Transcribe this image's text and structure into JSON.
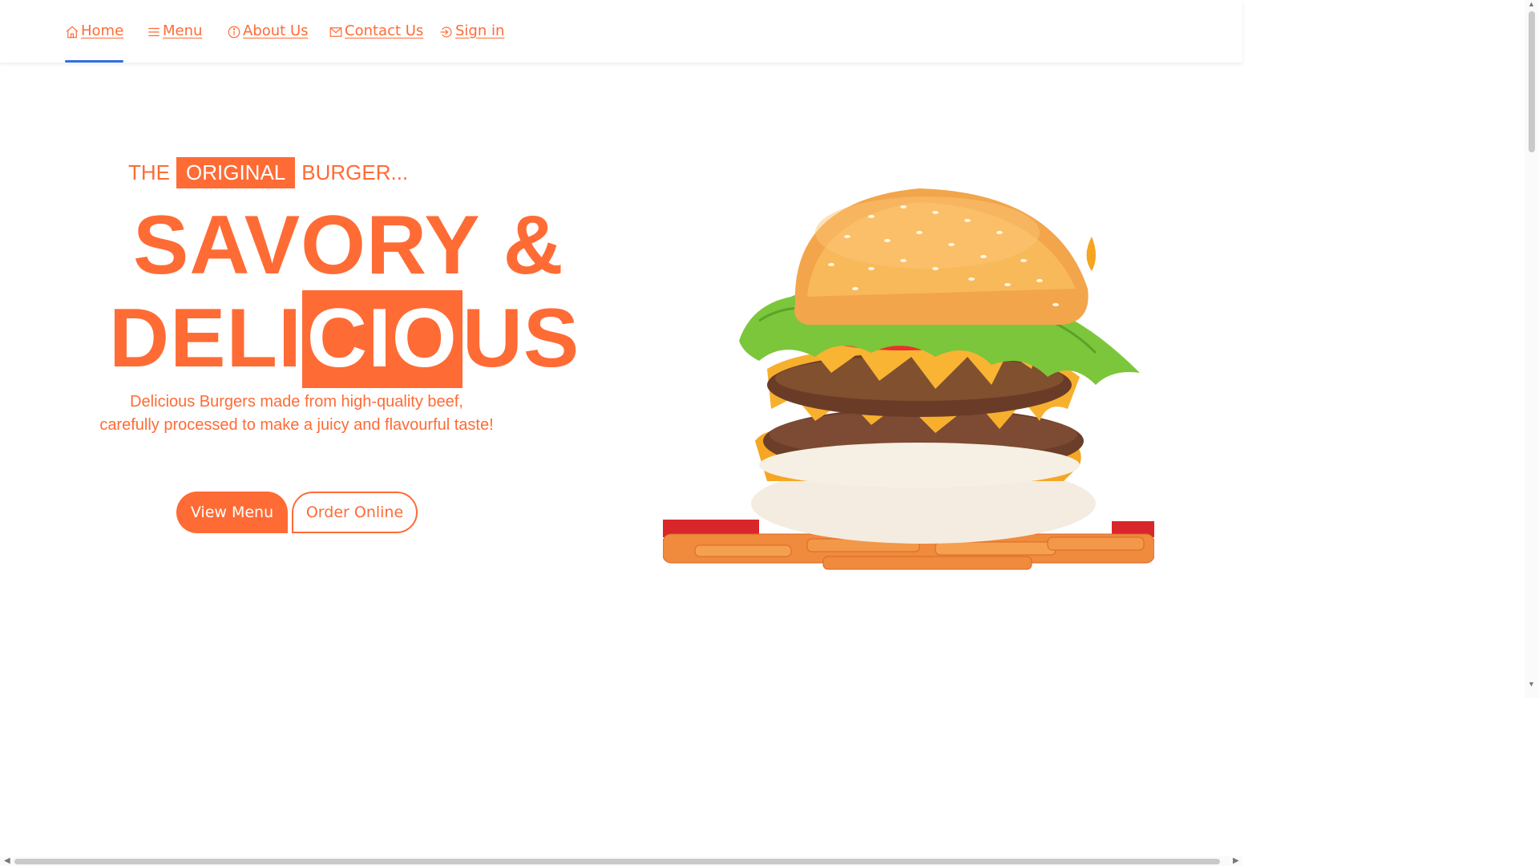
{
  "colors": {
    "accent": "#ff6b35",
    "active_underline": "#2f6fe0"
  },
  "nav": {
    "items": [
      {
        "label": "Home",
        "icon": "home-icon",
        "active": true
      },
      {
        "label": "Menu",
        "icon": "menu-icon"
      },
      {
        "label": "About Us",
        "icon": "info-icon"
      },
      {
        "label": "Contact Us",
        "icon": "mail-icon"
      },
      {
        "label": "Sign in",
        "icon": "sign-in-icon"
      }
    ]
  },
  "hero": {
    "tagline": {
      "before": "THE",
      "highlight": "ORIGINAL",
      "after": "BURGER..."
    },
    "headline_line1": "SAVORY &",
    "headline_line2": {
      "before": "DELI",
      "highlight": "CIO",
      "after": "US"
    },
    "description_line1": "Delicious Burgers made from high-quality beef,",
    "description_line2": "carefully processed to make a juicy and flavourful taste!",
    "primary_button": "View Menu",
    "secondary_button": "Order Online",
    "image": "burger-photo"
  }
}
